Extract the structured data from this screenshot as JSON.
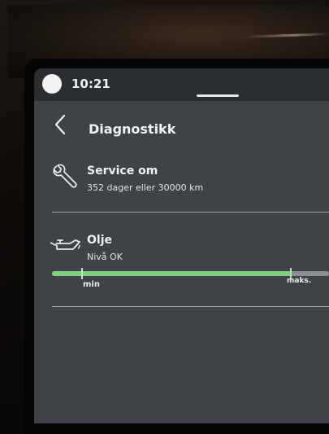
{
  "status_bar": {
    "time": "10:21"
  },
  "header": {
    "title": "Diagnostikk"
  },
  "service": {
    "title": "Service om",
    "detail": "352 dager eller 30000 km"
  },
  "oil": {
    "title": "Olje",
    "status": "Nivå OK",
    "level_fraction": 0.86,
    "min_label": "min",
    "max_label": "maks."
  },
  "colors": {
    "screen_bg": "#3f4347",
    "statusbar_bg": "#2a2e33",
    "level_fill": "#7ed37a",
    "level_track": "#8a8f95",
    "text": "#f0f0f0"
  },
  "icons": {
    "back": "chevron-left-icon",
    "service": "wrench-icon",
    "oil": "oil-can-icon",
    "profile": "profile-avatar-icon"
  }
}
